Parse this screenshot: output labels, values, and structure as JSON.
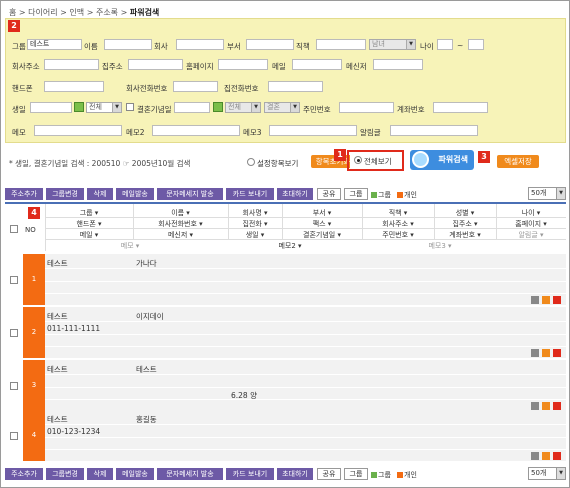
{
  "breadcrumb": {
    "items": [
      "홈",
      ">",
      "다이어리",
      ">",
      "인맥",
      ">",
      "주소록",
      ">"
    ],
    "current": "파워검색"
  },
  "badges": [
    "1",
    "2",
    "3",
    "4"
  ],
  "search_form": {
    "group_label": "그룹",
    "group_value": "테스트",
    "name_label": "이름",
    "company_label": "회사",
    "dept_label": "부서",
    "position_label": "직책",
    "gender_value": "남녀",
    "age_label": "나이",
    "age_sep": "~",
    "company_addr_label": "회사주소",
    "home_addr_label": "집주소",
    "homepage_label": "홈페이지",
    "email_label": "메일",
    "messenger_label": "메신저",
    "mobile_label": "핸드폰",
    "company_phone_label": "회사전화번호",
    "home_phone_label": "집전화번호",
    "birthday_label": "생일",
    "birthday_select": "전체",
    "anniversary_label": "결혼기념일",
    "anniversary_select": "전체",
    "marriage_select": "결혼",
    "resident_label": "주민번호",
    "account_label": "계좌번호",
    "memo_label": "메모",
    "memo2_label": "메모2",
    "memo3_label": "메모3",
    "alert_label": "알림글"
  },
  "search_note": "* 생일, 결혼기념일 검색 : 200510 ☞ 2005년10월 검색",
  "view_options": {
    "custom_label": "설정항목보기",
    "init_label": "항목초기화",
    "all_label": "전체보기",
    "search_button": "파워검색",
    "excel_button": "엑셀저장"
  },
  "toolbar": {
    "buttons": [
      "주소추가",
      "그룹변경",
      "삭제",
      "메일발송",
      "문자메세지 발송",
      "카드 보내기",
      "초대하기"
    ],
    "share": "공유",
    "group": "그룹",
    "legend_group": "그룹",
    "legend_personal": "개인",
    "page_size": "50개"
  },
  "table_header": {
    "no": "NO",
    "row1": [
      "그룹 ▾",
      "이름 ▾",
      "회사명 ▾",
      "부서 ▾",
      "직책 ▾",
      "성별 ▾",
      "나이 ▾"
    ],
    "row2": [
      "핸드폰 ▾",
      "회사전화번호 ▾",
      "집전화 ▾",
      "팩스 ▾",
      "회사주소 ▾",
      "집주소 ▾",
      "홈페이지 ▾"
    ],
    "row3": [
      "메일 ▾",
      "메신저 ▾",
      "생일 ▾",
      "결혼기념일 ▾",
      "주민번호 ▾",
      "계좌번호 ▾",
      "알림글 ▾"
    ],
    "row4": [
      "메모 ▾",
      "메모2 ▾",
      "메모3 ▾"
    ]
  },
  "rows": [
    {
      "no": "1",
      "group": "테스트",
      "name": "가나다",
      "phone": "",
      "date": ""
    },
    {
      "no": "2",
      "group": "테스트",
      "name": "이지데이",
      "phone": "011-111-1111",
      "date": ""
    },
    {
      "no": "3",
      "group": "테스트",
      "name": "테스트",
      "phone": "",
      "date": "6.28 양"
    },
    {
      "no": "4",
      "group": "테스트",
      "name": "홍길동",
      "phone": "010-123-1234",
      "date": ""
    }
  ],
  "colors": {
    "accent_orange": "#f36b12",
    "toolbar_purple": "#6d5aa6",
    "panel_yellow": "#f7f3b8",
    "badge_red": "#e02a1b",
    "search_blue": "#3d8ddf"
  }
}
